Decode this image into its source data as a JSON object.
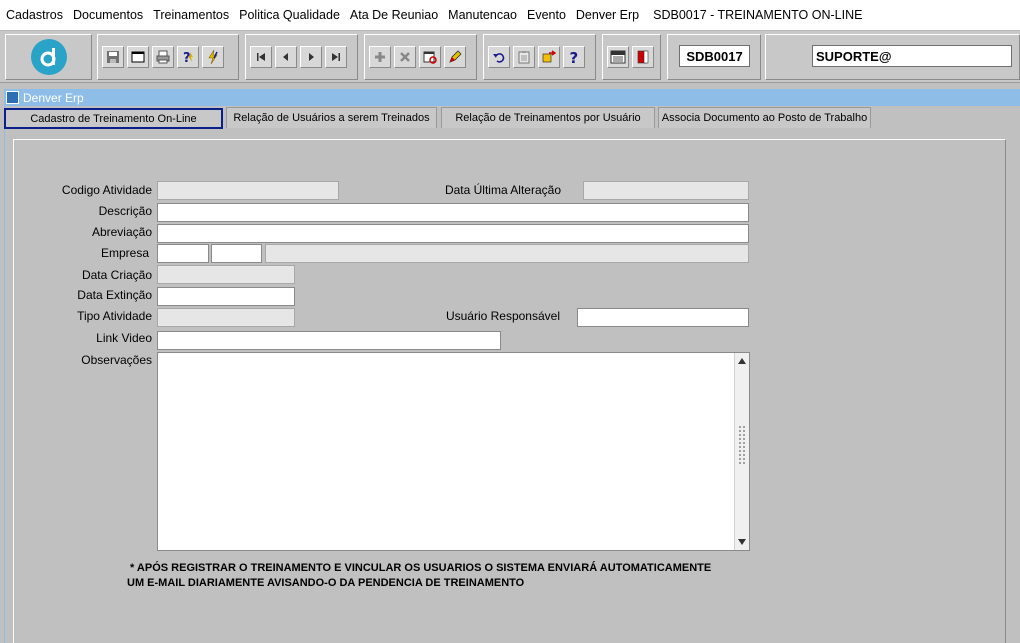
{
  "menu": {
    "items": [
      "Cadastros",
      "Documentos",
      "Treinamentos",
      "Politica Qualidade",
      "Ata De Reuniao",
      "Manutencao",
      "Evento",
      "Denver Erp"
    ],
    "title": "SDB0017 - TREINAMENTO ON-LINE"
  },
  "toolbar": {
    "code": "SDB0017",
    "user": "SUPORTE@"
  },
  "window": {
    "title": "Denver Erp"
  },
  "tabs": [
    {
      "label": "Cadastro de Treinamento On-Line",
      "active": true
    },
    {
      "label": "Relação de Usuários a serem Treinados",
      "active": false
    },
    {
      "label": "Relação de Treinamentos por Usuário",
      "active": false
    },
    {
      "label": "Associa Documento ao Posto de Trabalho",
      "active": false
    }
  ],
  "form": {
    "codigo_atividade": {
      "label": "Codigo Atividade",
      "value": ""
    },
    "data_ultima_alteracao": {
      "label": "Data Última Alteração",
      "value": ""
    },
    "descricao": {
      "label": "Descrição",
      "value": ""
    },
    "abreviacao": {
      "label": "Abreviação",
      "value": ""
    },
    "empresa": {
      "label": "Empresa",
      "value1": "",
      "value2": "",
      "value3": ""
    },
    "data_criacao": {
      "label": "Data Criação",
      "value": ""
    },
    "data_extincao": {
      "label": "Data Extinção",
      "value": ""
    },
    "tipo_atividade": {
      "label": "Tipo Atividade",
      "value": ""
    },
    "usuario_responsavel": {
      "label": "Usuário Responsável",
      "value": ""
    },
    "link_video": {
      "label": "Link Video",
      "value": ""
    },
    "observacoes": {
      "label": "Observações",
      "value": ""
    }
  },
  "note": {
    "line1": "* APÓS REGISTRAR O TREINAMENTO E VINCULAR OS USUARIOS O SISTEMA ENVIARÁ AUTOMATICAMENTE",
    "line2": "UM E-MAIL DIARIAMENTE AVISANDO-O DA PENDENCIA DE TREINAMENTO"
  }
}
